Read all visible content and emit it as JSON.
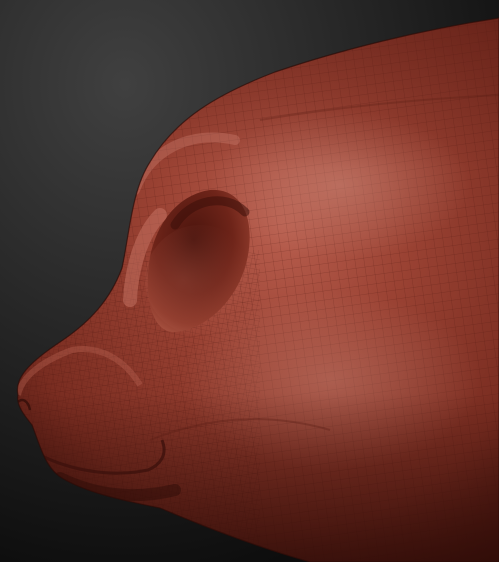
{
  "scene": {
    "subject": "sculpted-creature-head-side-view",
    "background_top_color": "#3a3a3a",
    "background_bottom_color": "#0c0c0c",
    "material_base_color": "#8a3528",
    "material_highlight_color": "#c46a5a",
    "material_shadow_color": "#3d120c",
    "wireframe_color": "#5a1d15"
  }
}
